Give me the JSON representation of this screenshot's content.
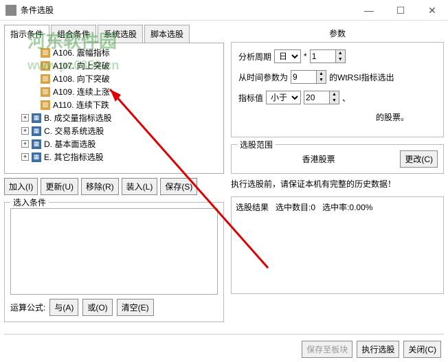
{
  "window": {
    "title": "条件选股"
  },
  "tabs": [
    "指示条件",
    "组合条件",
    "系统选股",
    "脚本选股"
  ],
  "tree": {
    "leaves": [
      "A106. 震幅指标",
      "A107. 向上突破",
      "A108. 向下突破",
      "A109. 连续上涨",
      "A110. 连续下跌"
    ],
    "branches": [
      "B. 成交量指标选股",
      "C. 交易系统选股",
      "D. 基本面选股",
      "E. 其它指标选股"
    ]
  },
  "buttons": {
    "add": "加入(I)",
    "update": "更新(U)",
    "remove": "移除(R)",
    "load": "装入(L)",
    "save": "保存(S)"
  },
  "selected_label": "选入条件",
  "formula": {
    "label": "运算公式:",
    "and": "与(A)",
    "or": "或(O)",
    "clear": "清空(E)"
  },
  "params": {
    "title": "参数",
    "row1": {
      "label": "分析周期",
      "value": "日",
      "mult": "*",
      "num": "1"
    },
    "row2": {
      "prefix": "从时间参数为",
      "num": "9",
      "suffix": "的WtRSI指标选出"
    },
    "row3": {
      "label": "指标值",
      "op": "小于",
      "num": "20",
      "comma": "、"
    },
    "row4": "的股票。"
  },
  "range": {
    "legend": "选股范围",
    "market": "香港股票",
    "change": "更改(C)"
  },
  "notice": "执行选股前，请保证本机有完整的历史数据！",
  "result": {
    "label": "选股结果",
    "count_label": "选中数目:",
    "count": "0",
    "rate_label": "选中率:",
    "rate": "0.00%"
  },
  "bottom": {
    "save_block": "保存至板块",
    "exec": "执行选股",
    "close": "关闭(C)"
  },
  "watermark": {
    "name": "河东软件园",
    "url": "www.pc0359.cn"
  }
}
